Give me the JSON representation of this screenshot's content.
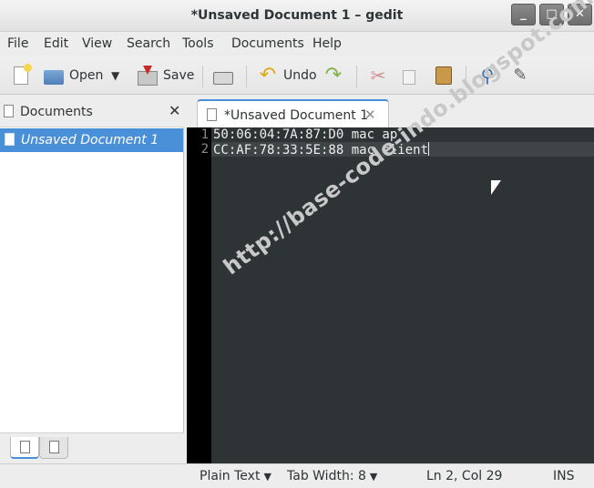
{
  "window": {
    "title": "*Unsaved Document 1 – gedit",
    "buttons": {
      "minimize": "_",
      "maximize": "□",
      "close": "✕"
    }
  },
  "menubar": [
    "File",
    "Edit",
    "View",
    "Search",
    "Tools",
    "Documents",
    "Help"
  ],
  "toolbar": {
    "open_label": "Open",
    "save_label": "Save",
    "undo_label": "Undo"
  },
  "sidepanel": {
    "title": "Documents",
    "close_glyph": "✕",
    "documents": [
      "Unsaved Document 1"
    ]
  },
  "editor": {
    "tab_label": "*Unsaved Document 1",
    "tab_close": "✕",
    "lines": [
      {
        "num": "1",
        "text": "50:06:04:7A:87:D0 mac ap"
      },
      {
        "num": "2",
        "text": "CC:AF:78:33:5E:88 mac client"
      }
    ],
    "watermark": "http://base-code-indo.blogspot.com/"
  },
  "statusbar": {
    "language": "Plain Text",
    "tab_width_label": "Tab Width:",
    "tab_width_value": "8",
    "position": "Ln 2, Col 29",
    "mode": "INS"
  },
  "colors": {
    "accent": "#4a90d9",
    "editor_bg": "#2e3436",
    "editor_text": "#eeeeec"
  }
}
